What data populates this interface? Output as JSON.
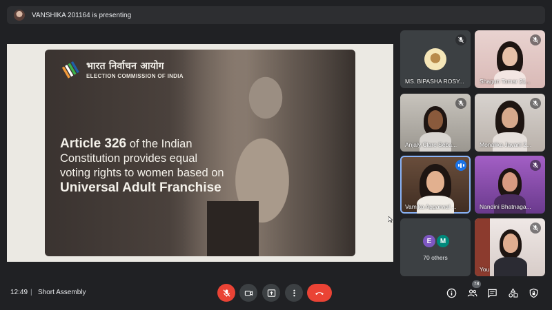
{
  "presenting": {
    "text": "VANSHIKA 201164 is presenting"
  },
  "slide": {
    "org_hindi": "भारत निर्वाचन आयोग",
    "org_english": "ELECTION COMMISSION OF INDIA",
    "line1_bold": "Article 326",
    "line1_rest": " of the Indian",
    "line2": "Constitution provides equal",
    "line3": "voting rights to women based on",
    "line4": "Universal Adult Franchise"
  },
  "participants": [
    {
      "name": "MS. BIPASHA ROSY...",
      "muted": true
    },
    {
      "name": "Shagun Tomar 21...",
      "muted": true
    },
    {
      "name": "Anjaly Clare Seba...",
      "muted": true
    },
    {
      "name": "Monalika Jayani 2...",
      "muted": true
    },
    {
      "name": "Vamika Aggarwal ...",
      "muted": false,
      "speaking": true
    },
    {
      "name": "Nandini Bhatnaga...",
      "muted": true
    },
    {
      "name": "You",
      "muted": true
    }
  ],
  "others": {
    "initials": [
      "E",
      "M"
    ],
    "label": "70 others"
  },
  "bottom": {
    "time": "12:49",
    "separator": "|",
    "meeting_name": "Short Assembly",
    "people_count": "78"
  },
  "icons": {
    "mic_off": "mic-off-icon",
    "camera": "camera-icon",
    "present": "present-screen-icon",
    "more": "more-vert-icon",
    "end_call": "end-call-icon",
    "info": "info-icon",
    "people": "people-icon",
    "chat": "chat-icon",
    "activities": "activities-icon",
    "host_controls": "host-controls-icon"
  },
  "colors": {
    "end_call": "#ea4335",
    "speaking": "#1a73e8",
    "active_outline": "#8ab4f8"
  }
}
